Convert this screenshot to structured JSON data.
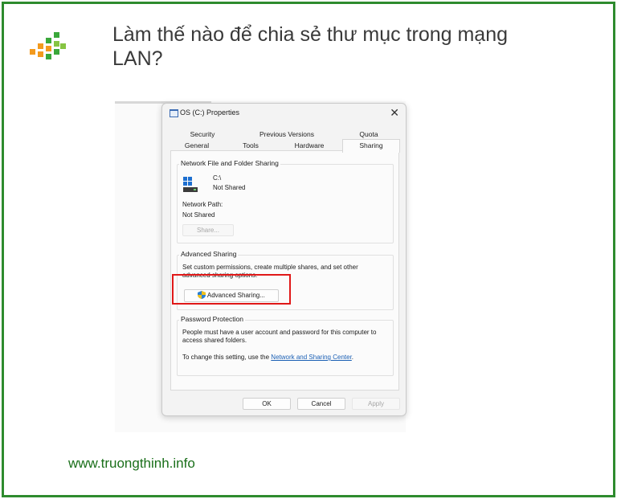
{
  "article": {
    "title": "Làm thế nào để chia sẻ thư mục trong mạng LAN?",
    "website": "www.truongthinh.info"
  },
  "colors": {
    "frame": "#2e8b2e",
    "highlight": "#e01818",
    "logo": [
      "#f39a1e",
      "#3aa83a",
      "#86c442"
    ]
  },
  "dialog": {
    "title": "OS (C:) Properties",
    "close_glyph": "✕",
    "tabs_row1": [
      "Security",
      "Previous Versions",
      "Quota"
    ],
    "tabs_row2": [
      "General",
      "Tools",
      "Hardware",
      "Sharing"
    ],
    "active_tab": "Sharing",
    "network_sharing": {
      "label": "Network File and Folder Sharing",
      "drive": "C:\\",
      "status": "Not Shared",
      "path_label": "Network Path:",
      "path_value": "Not Shared",
      "share_button": "Share..."
    },
    "advanced_sharing": {
      "label": "Advanced Sharing",
      "description": "Set custom permissions, create multiple shares, and set other advanced sharing options.",
      "button": "Advanced Sharing..."
    },
    "password_protection": {
      "label": "Password Protection",
      "description": "People must have a user account and password for this computer to access shared folders.",
      "change_prefix": "To change this setting, use the ",
      "change_link": "Network and Sharing Center",
      "change_suffix": "."
    },
    "buttons": {
      "ok": "OK",
      "cancel": "Cancel",
      "apply": "Apply"
    }
  }
}
